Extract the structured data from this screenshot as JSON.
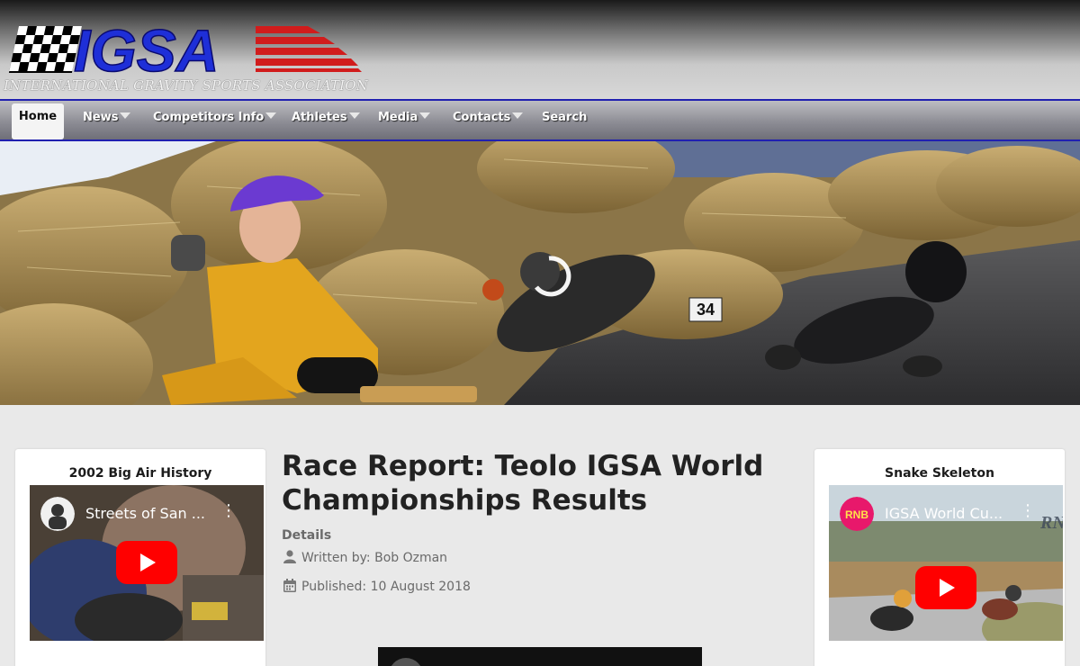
{
  "site": {
    "logo_text": "IGSA",
    "tagline": "INTERNATIONAL GRAVITY SPORTS ASSOCIATION",
    "colors": {
      "logo_blue": "#1e2fd8",
      "logo_red": "#d11c1c",
      "nav_border": "#2020b0"
    }
  },
  "nav": {
    "items": [
      {
        "label": "Home",
        "icon": "",
        "active": true
      },
      {
        "label": "News",
        "icon": "caret-down-icon"
      },
      {
        "label": "Competitors Info",
        "icon": "caret-down-icon"
      },
      {
        "label": "Athletes",
        "icon": "caret-down-icon"
      },
      {
        "label": "Media",
        "icon": "caret-down-icon"
      },
      {
        "label": "Contacts",
        "icon": "caret-down-icon"
      },
      {
        "label": "Search",
        "icon": ""
      }
    ]
  },
  "hero": {
    "bib_number": "34"
  },
  "left_module": {
    "title": "2002 Big Air History",
    "video_title": "Streets of San ..."
  },
  "article": {
    "title": "Race Report: Teolo IGSA World Championships Results",
    "details_label": "Details",
    "written_by": "Written by: Bob Ozman",
    "published": "Published: 10 August 2018"
  },
  "right_module": {
    "title": "Snake Skeleton",
    "video_title": "IGSA World Cu...",
    "channel_badge": "RNB",
    "watermark": "RN"
  }
}
